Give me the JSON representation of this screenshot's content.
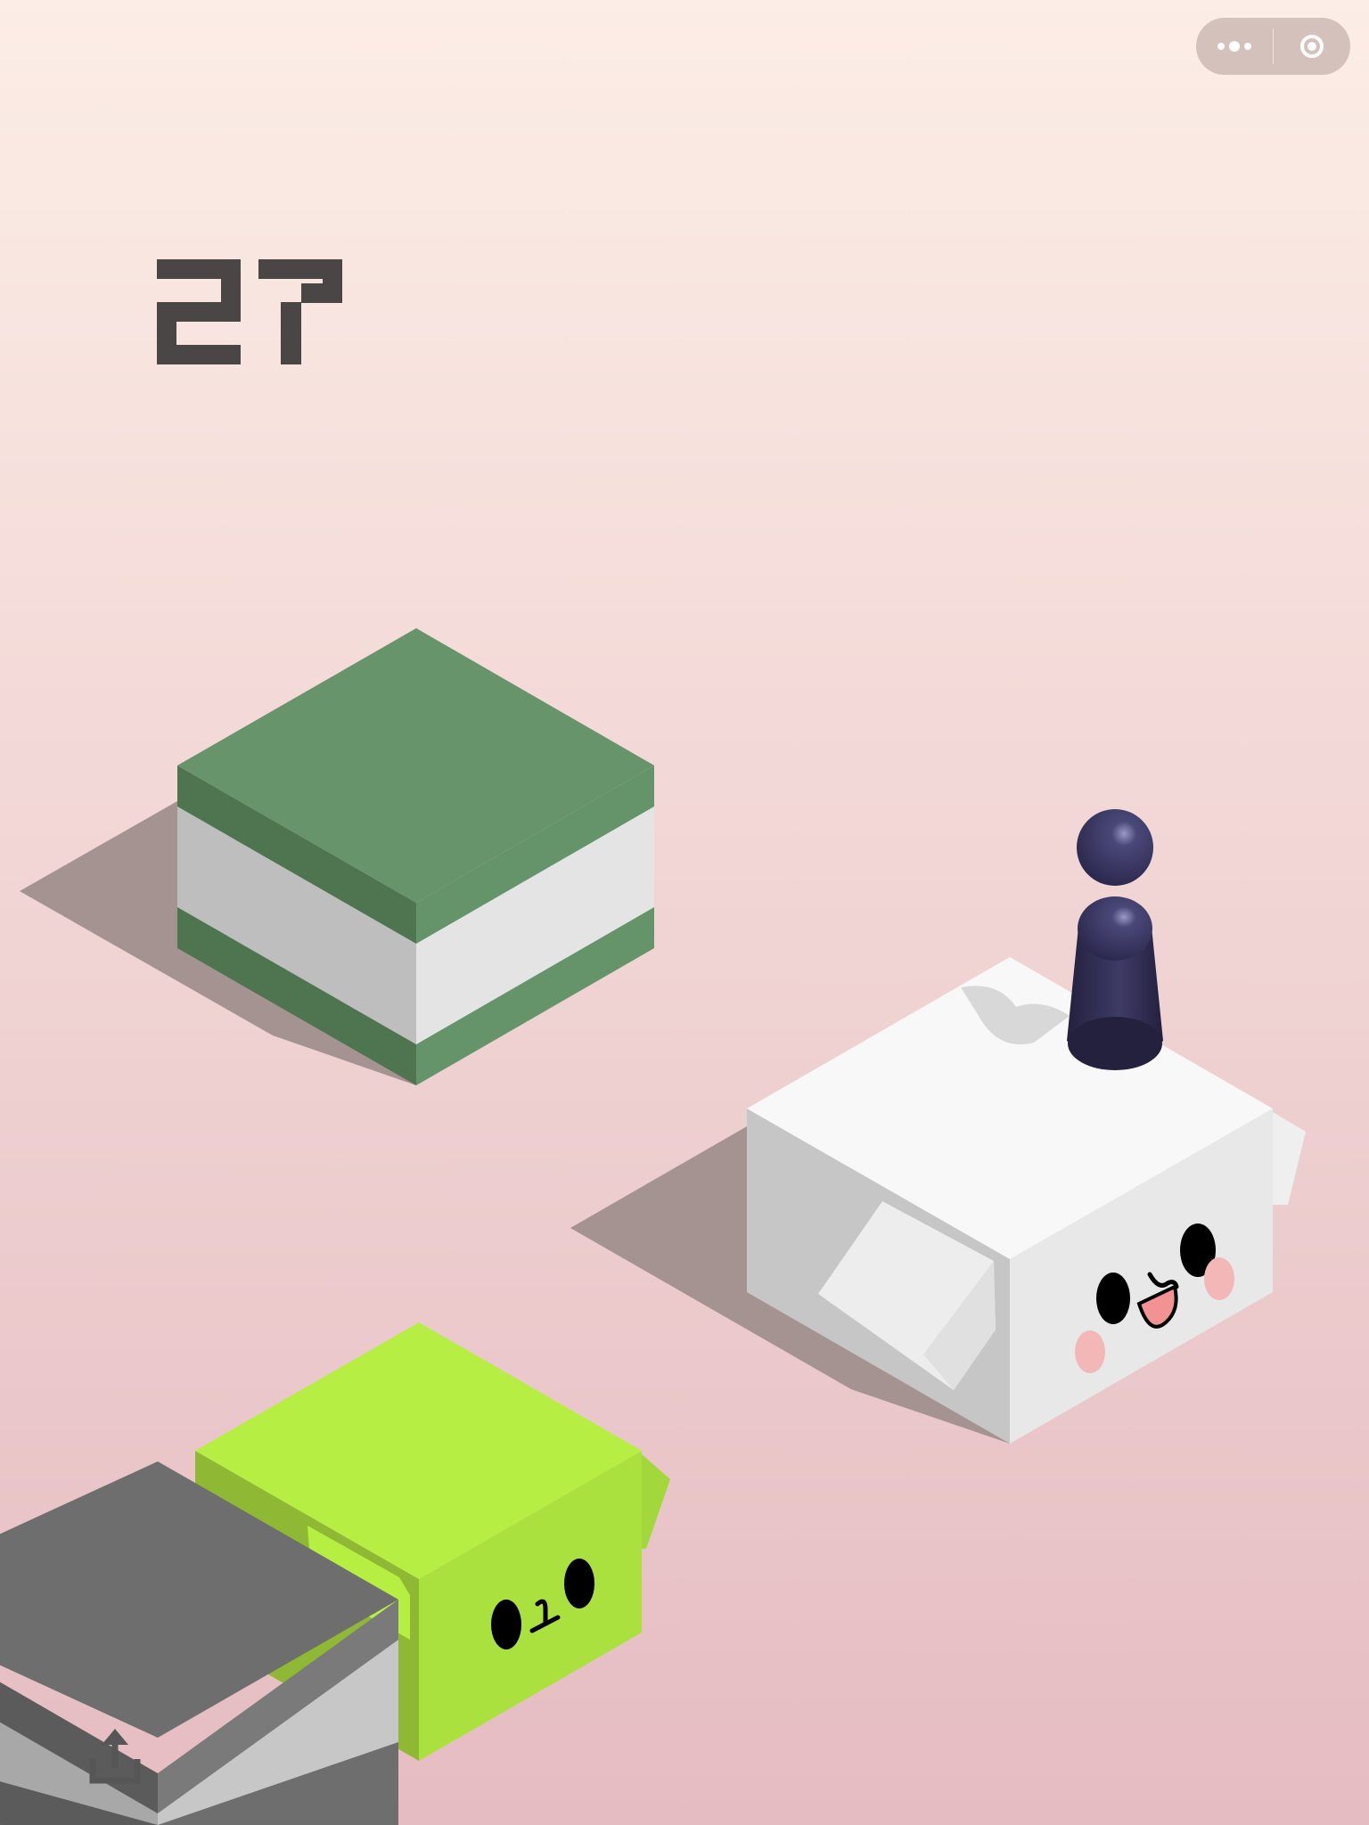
{
  "game": {
    "score": "27"
  },
  "colors": {
    "background_top": "#fcede6",
    "background_bottom": "#e5bcc2",
    "score_color": "#4a4646",
    "green_block": "#67946a",
    "white_block": "#f8f8f8",
    "lime_block": "#b7ee44",
    "gray_block": "#6e6e6e",
    "player": "#2f2c5a"
  },
  "icons": {
    "capsule_menu": "more-dots-icon",
    "capsule_close": "target-circle-icon",
    "share": "share-icon"
  }
}
